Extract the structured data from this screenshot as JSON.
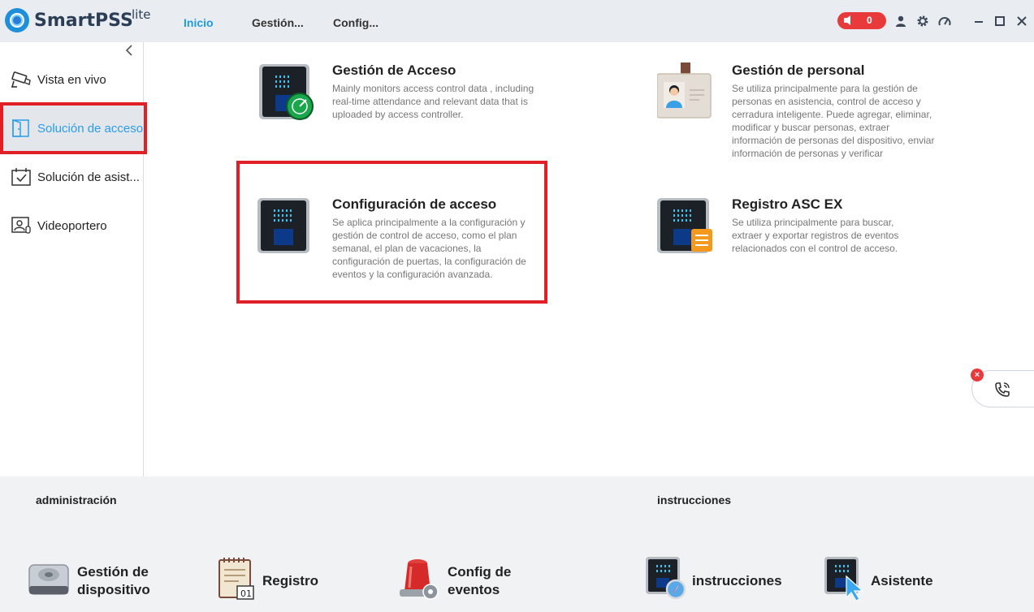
{
  "app": {
    "name": "SmartPSS",
    "edition": "lite"
  },
  "nav": {
    "tabs": [
      "Inicio",
      "Gestión...",
      "Config..."
    ],
    "active_tab": "Inicio"
  },
  "alarm": {
    "count": "0"
  },
  "sidebar": {
    "items": [
      {
        "label": "Vista en vivo",
        "icon": "camera-icon"
      },
      {
        "label": "Solución de acceso",
        "icon": "door-icon"
      },
      {
        "label": "Solución de asist...",
        "icon": "calendar-check-icon"
      },
      {
        "label": "Videoportero",
        "icon": "intercom-icon"
      }
    ],
    "active_index": 1
  },
  "cards": [
    {
      "title": "Gestión de Acceso",
      "desc": "Mainly monitors access control data , including real-time attendance and relevant data that is uploaded by access controller."
    },
    {
      "title": "Gestión de personal",
      "desc": "Se utiliza principalmente para la gestión de personas en asistencia, control de acceso y cerradura inteligente. Puede agregar, eliminar, modificar y buscar personas, extraer información de personas del dispositivo, enviar información de personas y verificar"
    },
    {
      "title": "Configuración de acceso",
      "desc": "Se aplica principalmente a la configuración y gestión de control de acceso, como el plan semanal, el plan de vacaciones, la configuración de puertas, la configuración de eventos y la configuración avanzada."
    },
    {
      "title": "Registro ASC EX",
      "desc": "Se utiliza principalmente para buscar, extraer y exportar registros de eventos relacionados con el control de acceso."
    }
  ],
  "bottom": {
    "admin_title": "administración",
    "instructions_title": "instrucciones",
    "admin_items": [
      {
        "label_line1": "Gestión de",
        "label_line2": "dispositivo",
        "icon": "device-icon"
      },
      {
        "label_line1": "Registro",
        "label_line2": "",
        "icon": "log-icon"
      },
      {
        "label_line1": "Config de",
        "label_line2": "eventos",
        "icon": "alarm-light-icon"
      }
    ],
    "instruction_items": [
      {
        "label_line1": "instrucciones",
        "label_line2": "",
        "icon": "guide-icon"
      },
      {
        "label_line1": "Asistente",
        "label_line2": "",
        "icon": "wizard-icon"
      }
    ]
  },
  "colors": {
    "accent": "#1e9be8",
    "highlight": "#e01f26",
    "alarm": "#e8393b"
  }
}
